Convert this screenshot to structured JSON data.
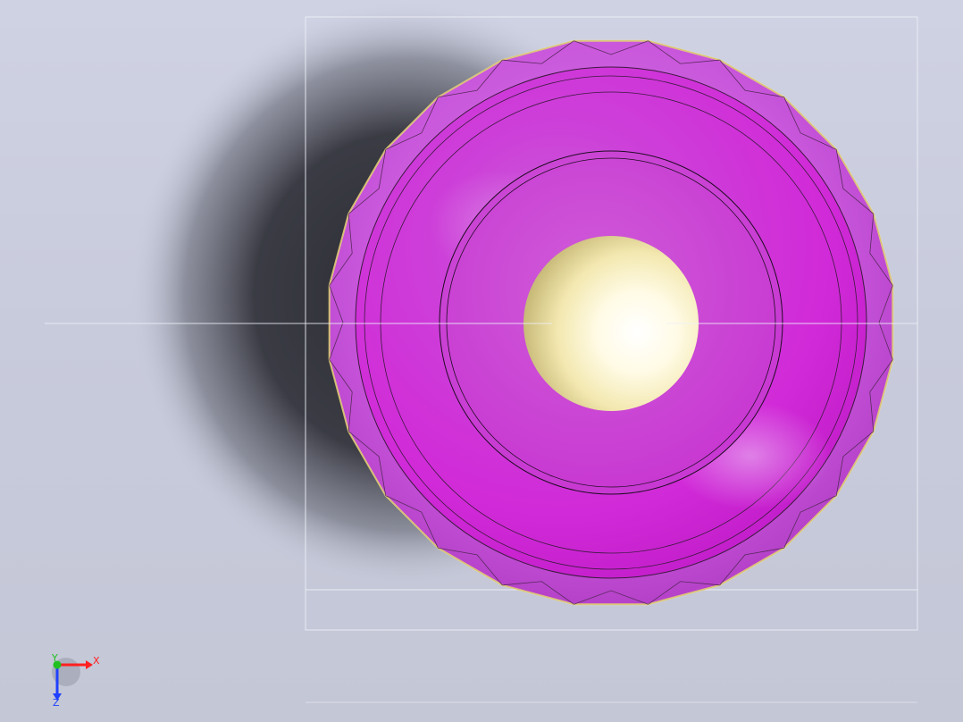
{
  "viewport": {
    "background_color": "#c9ccdc",
    "shadow_color": "#2b2c33"
  },
  "model": {
    "outer_shell_color": "#c94fdc",
    "inner_body_color": "#d02ad8",
    "edge_highlight_color": "#f2e27a",
    "center_sphere_color": "#fbf4c4"
  },
  "triad": {
    "x_label": "X",
    "y_label": "Y",
    "z_label": "Z",
    "x_color": "#ff2020",
    "y_color": "#20c020",
    "z_color": "#2040ff"
  }
}
